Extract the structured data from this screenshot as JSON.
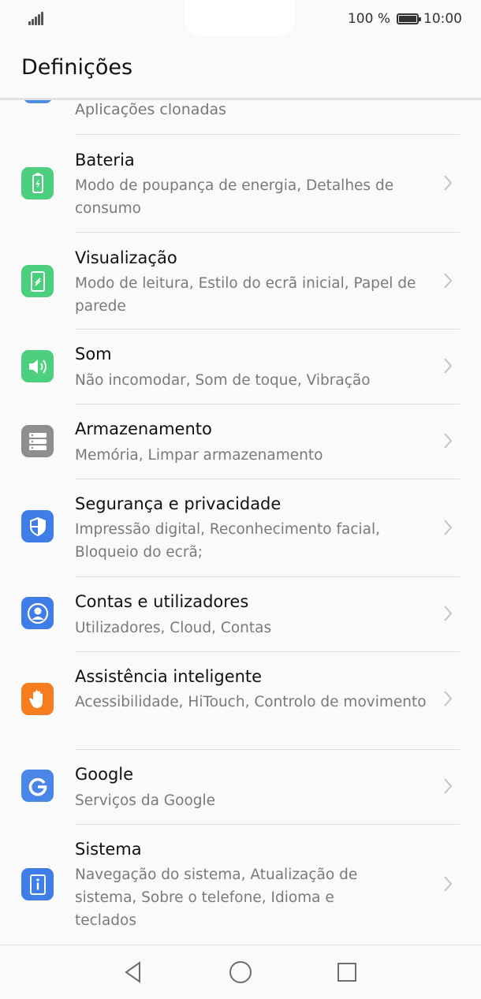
{
  "status_bar": {
    "battery_text": "100 %",
    "time": "10:00"
  },
  "header": {
    "title": "Definições"
  },
  "partial_item": {
    "label": "Aplicações clonadas"
  },
  "items": [
    {
      "title": "Bateria",
      "subtitle": "Modo de poupança de energia, Detalhes de consumo",
      "icon": "battery-icon",
      "color": "#4cd07d"
    },
    {
      "title": "Visualização",
      "subtitle": "Modo de leitura, Estilo do ecrã inicial, Papel de parede",
      "icon": "display-icon",
      "color": "#4cd07d"
    },
    {
      "title": "Som",
      "subtitle": "Não incomodar, Som de toque, Vibração",
      "icon": "sound-icon",
      "color": "#4cd07d"
    },
    {
      "title": "Armazenamento",
      "subtitle": "Memória, Limpar armazenamento",
      "icon": "storage-icon",
      "color": "#8e8e8e"
    },
    {
      "title": "Segurança e privacidade",
      "subtitle": "Impressão digital, Reconhecimento facial, Bloqueio do ecrã;",
      "icon": "shield-icon",
      "color": "#3f7ee8"
    },
    {
      "title": "Contas e utilizadores",
      "subtitle": "Utilizadores, Cloud, Contas",
      "icon": "user-icon",
      "color": "#3f7ee8"
    },
    {
      "title": "Assistência inteligente",
      "subtitle": "Acessibilidade, HiTouch, Controlo de movimento",
      "icon": "hand-icon",
      "color": "#f57c1f"
    },
    {
      "title": "Google",
      "subtitle": "Serviços da Google",
      "icon": "google-icon",
      "color": "#4a86e8"
    },
    {
      "title": "Sistema",
      "subtitle": "Navegação do sistema, Atualização de sistema, Sobre o telefone, Idioma e teclados",
      "icon": "info-icon",
      "color": "#3f7ee8"
    }
  ]
}
